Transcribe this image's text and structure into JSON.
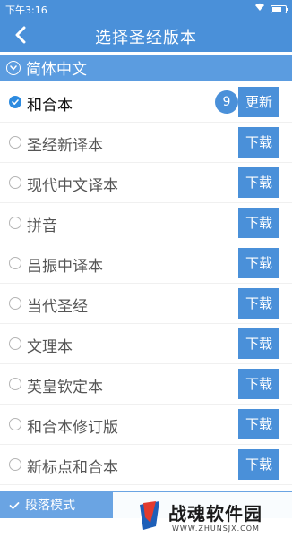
{
  "status_bar": {
    "time": "下午3:16",
    "icons": [
      "wifi-icon",
      "battery-icon"
    ]
  },
  "header": {
    "title": "选择圣经版本",
    "back_icon": "chevron-left-icon"
  },
  "section": {
    "title": "简体中文",
    "icon": "chevron-down-circle-icon",
    "expanded": true
  },
  "versions": [
    {
      "name": "和合本",
      "selected": true,
      "count": "9",
      "action": "更新"
    },
    {
      "name": "圣经新译本",
      "selected": false,
      "action": "下载"
    },
    {
      "name": "现代中文译本",
      "selected": false,
      "action": "下载"
    },
    {
      "name": "拼音",
      "selected": false,
      "action": "下载"
    },
    {
      "name": "吕振中译本",
      "selected": false,
      "action": "下载"
    },
    {
      "name": "当代圣经",
      "selected": false,
      "action": "下载"
    },
    {
      "name": "文理本",
      "selected": false,
      "action": "下载"
    },
    {
      "name": "英皇钦定本",
      "selected": false,
      "action": "下载"
    },
    {
      "name": "和合本修订版",
      "selected": false,
      "action": "下载"
    },
    {
      "name": "新标点和合本",
      "selected": false,
      "action": "下载"
    }
  ],
  "bottom_bar": {
    "label": "段落模式",
    "checked": true
  },
  "watermark": {
    "title": "战魂软件园",
    "url": "WWW.ZHUNSJX.COM"
  },
  "colors": {
    "primary": "#4a90d9",
    "section": "#5b9ce0",
    "bottom_bar": "#6aa4e3",
    "selected_radio": "#2d8be0"
  }
}
